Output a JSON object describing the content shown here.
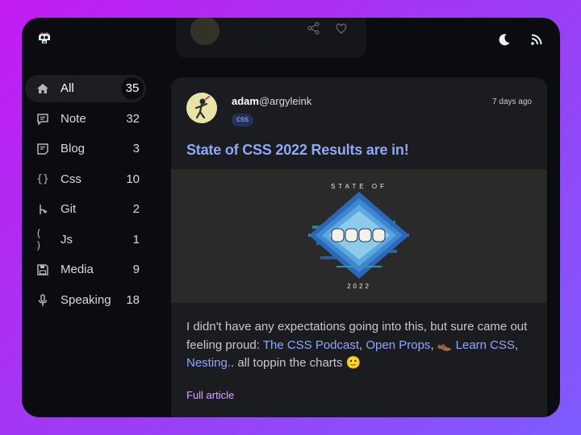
{
  "header": {
    "logo_icon": "skull-logo-icon",
    "theme_icon": "moon-icon",
    "feed_icon": "rss-icon",
    "ghost_card_icons": [
      "share-icon",
      "heart-icon"
    ]
  },
  "sidebar": {
    "items": [
      {
        "label": "All",
        "count": "35",
        "icon": "home-icon"
      },
      {
        "label": "Note",
        "count": "32",
        "icon": "message-icon"
      },
      {
        "label": "Blog",
        "count": "3",
        "icon": "document-icon"
      },
      {
        "label": "Css",
        "count": "10",
        "icon": "braces-icon"
      },
      {
        "label": "Git",
        "count": "2",
        "icon": "git-branch-icon"
      },
      {
        "label": "Js",
        "count": "1",
        "icon": "parentheses-icon"
      },
      {
        "label": "Media",
        "count": "9",
        "icon": "save-icon"
      },
      {
        "label": "Speaking",
        "count": "18",
        "icon": "microphone-icon"
      }
    ]
  },
  "post": {
    "author_user": "adam",
    "author_handle": "@argyleink",
    "tag": "css",
    "date": "7 days ago",
    "title": "State of CSS 2022 Results are in!",
    "hero": {
      "top_text": "STATE OF",
      "bottom_text": "2022"
    },
    "body": {
      "intro": "I didn't have any expectations going into this, but sure came out feeling proud: ",
      "link1": "The CSS Podcast",
      "sep1": ", ",
      "link2": "Open Props",
      "sep2": ", ",
      "link3_emoji": "👞",
      "link3": " Learn CSS",
      "sep3": ", ",
      "link4": "Nesting.",
      "outro": ". all toppin the charts 🙂"
    },
    "full_article_label": "Full article"
  },
  "colors": {
    "background_gradient_start": "#c21cf0",
    "background_gradient_end": "#7f5cff",
    "window": "#0b0c0f",
    "card": "#1b1c20",
    "title_link": "#8ea7ff",
    "full_article": "#d7a6ff",
    "tag_bg": "#24305a"
  }
}
